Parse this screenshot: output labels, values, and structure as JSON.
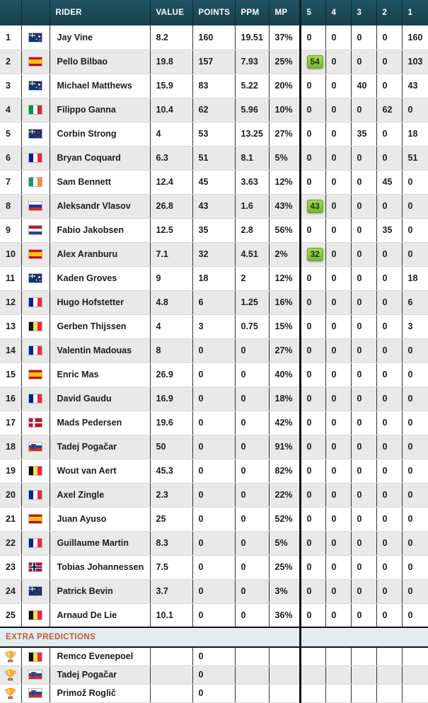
{
  "table": {
    "columns": [
      {
        "key": "rank",
        "label": ""
      },
      {
        "key": "flag",
        "label": ""
      },
      {
        "key": "rider",
        "label": "RIDER"
      },
      {
        "key": "value",
        "label": "VALUE"
      },
      {
        "key": "points",
        "label": "POINTS"
      },
      {
        "key": "ppm",
        "label": "PPM"
      },
      {
        "key": "mp",
        "label": "MP"
      },
      {
        "key": "p5",
        "label": "5"
      },
      {
        "key": "p4",
        "label": "4"
      },
      {
        "key": "p3",
        "label": "3"
      },
      {
        "key": "p2",
        "label": "2"
      },
      {
        "key": "p1",
        "label": "1"
      }
    ],
    "rows": [
      {
        "rank": "1",
        "country": "AU",
        "rider": "Jay Vine",
        "value": "8.2",
        "points": "160",
        "ppm": "19.51",
        "mp": "37%",
        "p5": "0",
        "p4": "0",
        "p3": "0",
        "p2": "0",
        "p1": "160",
        "highlight": null
      },
      {
        "rank": "2",
        "country": "ES",
        "rider": "Pello Bilbao",
        "value": "19.8",
        "points": "157",
        "ppm": "7.93",
        "mp": "25%",
        "p5": "54",
        "p4": "0",
        "p3": "0",
        "p2": "0",
        "p1": "103",
        "highlight": "p5"
      },
      {
        "rank": "3",
        "country": "AU",
        "rider": "Michael Matthews",
        "value": "15.9",
        "points": "83",
        "ppm": "5.22",
        "mp": "20%",
        "p5": "0",
        "p4": "0",
        "p3": "40",
        "p2": "0",
        "p1": "43",
        "highlight": null
      },
      {
        "rank": "4",
        "country": "IT",
        "rider": "Filippo Ganna",
        "value": "10.4",
        "points": "62",
        "ppm": "5.96",
        "mp": "10%",
        "p5": "0",
        "p4": "0",
        "p3": "0",
        "p2": "62",
        "p1": "0",
        "highlight": null
      },
      {
        "rank": "5",
        "country": "NZ",
        "rider": "Corbin Strong",
        "value": "4",
        "points": "53",
        "ppm": "13.25",
        "mp": "27%",
        "p5": "0",
        "p4": "0",
        "p3": "35",
        "p2": "0",
        "p1": "18",
        "highlight": null
      },
      {
        "rank": "6",
        "country": "FR",
        "rider": "Bryan Coquard",
        "value": "6.3",
        "points": "51",
        "ppm": "8.1",
        "mp": "5%",
        "p5": "0",
        "p4": "0",
        "p3": "0",
        "p2": "0",
        "p1": "51",
        "highlight": null
      },
      {
        "rank": "7",
        "country": "IE",
        "rider": "Sam Bennett",
        "value": "12.4",
        "points": "45",
        "ppm": "3.63",
        "mp": "12%",
        "p5": "0",
        "p4": "0",
        "p3": "0",
        "p2": "45",
        "p1": "0",
        "highlight": null
      },
      {
        "rank": "8",
        "country": "RU",
        "rider": "Aleksandr Vlasov",
        "value": "26.8",
        "points": "43",
        "ppm": "1.6",
        "mp": "43%",
        "p5": "43",
        "p4": "0",
        "p3": "0",
        "p2": "0",
        "p1": "0",
        "highlight": "p5"
      },
      {
        "rank": "9",
        "country": "NL",
        "rider": "Fabio Jakobsen",
        "value": "12.5",
        "points": "35",
        "ppm": "2.8",
        "mp": "56%",
        "p5": "0",
        "p4": "0",
        "p3": "0",
        "p2": "35",
        "p1": "0",
        "highlight": null
      },
      {
        "rank": "10",
        "country": "ES",
        "rider": "Alex Aranburu",
        "value": "7.1",
        "points": "32",
        "ppm": "4.51",
        "mp": "2%",
        "p5": "32",
        "p4": "0",
        "p3": "0",
        "p2": "0",
        "p1": "0",
        "highlight": "p5"
      },
      {
        "rank": "11",
        "country": "AU",
        "rider": "Kaden Groves",
        "value": "9",
        "points": "18",
        "ppm": "2",
        "mp": "12%",
        "p5": "0",
        "p4": "0",
        "p3": "0",
        "p2": "0",
        "p1": "18",
        "highlight": null
      },
      {
        "rank": "12",
        "country": "FR",
        "rider": "Hugo Hofstetter",
        "value": "4.8",
        "points": "6",
        "ppm": "1.25",
        "mp": "16%",
        "p5": "0",
        "p4": "0",
        "p3": "0",
        "p2": "0",
        "p1": "6",
        "highlight": null
      },
      {
        "rank": "13",
        "country": "BE",
        "rider": "Gerben Thijssen",
        "value": "4",
        "points": "3",
        "ppm": "0.75",
        "mp": "15%",
        "p5": "0",
        "p4": "0",
        "p3": "0",
        "p2": "0",
        "p1": "3",
        "highlight": null
      },
      {
        "rank": "14",
        "country": "FR",
        "rider": "Valentin Madouas",
        "value": "8",
        "points": "0",
        "ppm": "0",
        "mp": "27%",
        "p5": "0",
        "p4": "0",
        "p3": "0",
        "p2": "0",
        "p1": "0",
        "highlight": null
      },
      {
        "rank": "15",
        "country": "ES",
        "rider": "Enric Mas",
        "value": "26.9",
        "points": "0",
        "ppm": "0",
        "mp": "40%",
        "p5": "0",
        "p4": "0",
        "p3": "0",
        "p2": "0",
        "p1": "0",
        "highlight": null
      },
      {
        "rank": "16",
        "country": "FR",
        "rider": "David Gaudu",
        "value": "16.9",
        "points": "0",
        "ppm": "0",
        "mp": "18%",
        "p5": "0",
        "p4": "0",
        "p3": "0",
        "p2": "0",
        "p1": "0",
        "highlight": null
      },
      {
        "rank": "17",
        "country": "DK",
        "rider": "Mads Pedersen",
        "value": "19.6",
        "points": "0",
        "ppm": "0",
        "mp": "42%",
        "p5": "0",
        "p4": "0",
        "p3": "0",
        "p2": "0",
        "p1": "0",
        "highlight": null
      },
      {
        "rank": "18",
        "country": "SI",
        "rider": "Tadej Pogačar",
        "value": "50",
        "points": "0",
        "ppm": "0",
        "mp": "91%",
        "p5": "0",
        "p4": "0",
        "p3": "0",
        "p2": "0",
        "p1": "0",
        "highlight": null
      },
      {
        "rank": "19",
        "country": "BE",
        "rider": "Wout van Aert",
        "value": "45.3",
        "points": "0",
        "ppm": "0",
        "mp": "82%",
        "p5": "0",
        "p4": "0",
        "p3": "0",
        "p2": "0",
        "p1": "0",
        "highlight": null
      },
      {
        "rank": "20",
        "country": "FR",
        "rider": "Axel Zingle",
        "value": "2.3",
        "points": "0",
        "ppm": "0",
        "mp": "22%",
        "p5": "0",
        "p4": "0",
        "p3": "0",
        "p2": "0",
        "p1": "0",
        "highlight": null
      },
      {
        "rank": "21",
        "country": "ES",
        "rider": "Juan Ayuso",
        "value": "25",
        "points": "0",
        "ppm": "0",
        "mp": "52%",
        "p5": "0",
        "p4": "0",
        "p3": "0",
        "p2": "0",
        "p1": "0",
        "highlight": null
      },
      {
        "rank": "22",
        "country": "FR",
        "rider": "Guillaume Martin",
        "value": "8.3",
        "points": "0",
        "ppm": "0",
        "mp": "5%",
        "p5": "0",
        "p4": "0",
        "p3": "0",
        "p2": "0",
        "p1": "0",
        "highlight": null
      },
      {
        "rank": "23",
        "country": "NO",
        "rider": "Tobias Johannessen",
        "value": "7.5",
        "points": "0",
        "ppm": "0",
        "mp": "25%",
        "p5": "0",
        "p4": "0",
        "p3": "0",
        "p2": "0",
        "p1": "0",
        "highlight": null
      },
      {
        "rank": "24",
        "country": "NZ",
        "rider": "Patrick Bevin",
        "value": "3.7",
        "points": "0",
        "ppm": "0",
        "mp": "3%",
        "p5": "0",
        "p4": "0",
        "p3": "0",
        "p2": "0",
        "p1": "0",
        "highlight": null
      },
      {
        "rank": "25",
        "country": "BE",
        "rider": "Arnaud De Lie",
        "value": "10.1",
        "points": "0",
        "ppm": "0",
        "mp": "36%",
        "p5": "0",
        "p4": "0",
        "p3": "0",
        "p2": "0",
        "p1": "0",
        "highlight": null
      }
    ],
    "extra_section": {
      "title": "EXTRA PREDICTIONS",
      "icon": "trophy-icon",
      "icon_glyph": "🏆",
      "rows": [
        {
          "country": "BE",
          "rider": "Remco Evenepoel",
          "value": "",
          "points": "0",
          "ppm": "",
          "mp": ""
        },
        {
          "country": "SI",
          "rider": "Tadej Pogačar",
          "value": "",
          "points": "0",
          "ppm": "",
          "mp": ""
        },
        {
          "country": "SI",
          "rider": "Primož Roglič",
          "value": "",
          "points": "0",
          "ppm": "",
          "mp": ""
        }
      ]
    }
  },
  "colors": {
    "header_bg": "#1d4a57",
    "header_text": "#ffffff",
    "row_odd": "#ffffff",
    "row_even": "#e9e9e9",
    "badge_green": "#8cc63f",
    "extra_band_bg": "#e2edf0",
    "extra_title_text": "#c4572e",
    "trophy_gold": "#e0a900"
  }
}
